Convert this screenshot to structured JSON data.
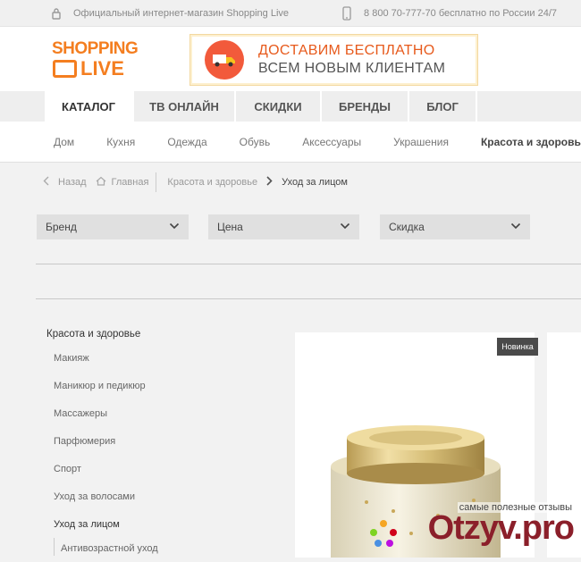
{
  "topbar": {
    "shop_text": "Официальный интернет-магазин Shopping Live",
    "phone_text": "8 800 70-777-70 бесплатно по России 24/7"
  },
  "header": {
    "logo_line1": "SHOPPING",
    "logo_line2": "LIVE",
    "banner_line1": "ДОСТАВИМ БЕСПЛАТНО",
    "banner_line2": "ВСЕМ НОВЫМ КЛИЕНТАМ"
  },
  "nav": {
    "tabs": [
      "КАТАЛОГ",
      "ТВ ОНЛАЙН",
      "СКИДКИ",
      "БРЕНДЫ",
      "БЛОГ"
    ]
  },
  "subnav": {
    "items": [
      "Дом",
      "Кухня",
      "Одежда",
      "Обувь",
      "Аксессуары",
      "Украшения",
      "Красота и здоровье"
    ]
  },
  "breadcrumb": {
    "back": "Назад",
    "home": "Главная",
    "level1": "Красота и здоровье",
    "current": "Уход за лицом"
  },
  "filters": {
    "brand": "Бренд",
    "price": "Цена",
    "discount": "Скидка"
  },
  "sidebar": {
    "heading": "Красота и здоровье",
    "items": [
      "Макияж",
      "Маникюр и педикюр",
      "Массажеры",
      "Парфюмерия",
      "Спорт",
      "Уход за волосами",
      "Уход за лицом"
    ],
    "subitem": "Антивозрастной уход"
  },
  "product": {
    "badge": "Новинка"
  },
  "watermark": {
    "tagline": "самые полезные отзывы",
    "logo": "Otzyv.pro"
  },
  "colors": {
    "brand_orange": "#f47e20",
    "banner_red": "#f25a3b",
    "badge_bg": "#4a4a4a"
  }
}
